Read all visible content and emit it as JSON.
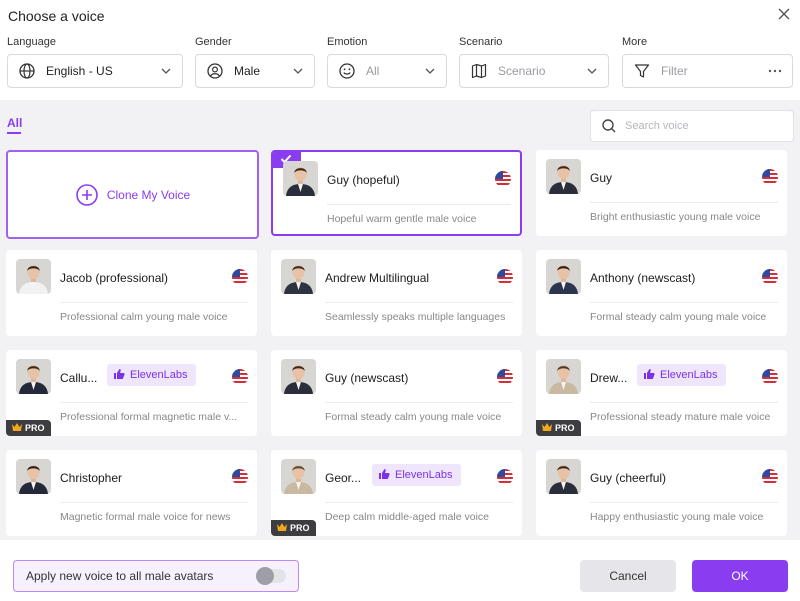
{
  "dialog": {
    "title": "Choose a voice"
  },
  "filters": {
    "language": {
      "label": "Language",
      "value": "English - US"
    },
    "gender": {
      "label": "Gender",
      "value": "Male"
    },
    "emotion": {
      "label": "Emotion",
      "value": "All"
    },
    "scenario": {
      "label": "Scenario",
      "value": "Scenario"
    },
    "more": {
      "label": "More",
      "value": "Filter"
    }
  },
  "tabs": {
    "all": "All"
  },
  "search": {
    "placeholder": "Search voice"
  },
  "clone": {
    "label": "Clone My Voice"
  },
  "badges": {
    "eleven": "ElevenLabs",
    "pro": "PRO"
  },
  "cards": [
    {
      "name": "Guy (hopeful)",
      "desc": "Hopeful warm gentle male voice",
      "selected": true,
      "suit": "#2a2d3a",
      "hair": "#3a2a1e"
    },
    {
      "name": "Guy",
      "desc": "Bright enthusiastic young male voice",
      "suit": "#2a2d3a",
      "hair": "#3a2a1e"
    },
    {
      "name": "Jacob (professional)",
      "desc": "Professional calm young male voice",
      "suit": "#f2f2f2",
      "hair": "#2e241c"
    },
    {
      "name": "Andrew Multilingual",
      "desc": "Seamlessly speaks multiple languages",
      "suit": "#2f3340",
      "hair": "#3b2c20"
    },
    {
      "name": "Anthony (newscast)",
      "desc": "Formal steady calm young male voice",
      "suit": "#2b3550",
      "hair": "#2a1f18"
    },
    {
      "name": "Callu...",
      "desc": "Professional formal magnetic male v...",
      "eleven": true,
      "pro": true,
      "suit": "#23283a",
      "hair": "#3a2a1e"
    },
    {
      "name": "Guy (newscast)",
      "desc": "Formal steady calm young male voice",
      "suit": "#2a2d3a",
      "hair": "#3a2a1e"
    },
    {
      "name": "Drew...",
      "desc": "Professional steady mature male voice",
      "eleven": true,
      "pro": true,
      "suit": "#c8b9a0",
      "hair": "#4a3a2c"
    },
    {
      "name": "Christopher",
      "desc": "Magnetic formal male voice for news",
      "suit": "#23283a",
      "hair": "#2a1f18"
    },
    {
      "name": "Geor...",
      "desc": "Deep calm middle-aged male voice",
      "eleven": true,
      "pro": true,
      "suit": "#c8b9a0",
      "hair": "#5a4a3a"
    },
    {
      "name": "Guy (cheerful)",
      "desc": "Happy enthusiastic young male voice",
      "suit": "#2a2d3a",
      "hair": "#3a2a1e"
    }
  ],
  "footer": {
    "apply_label": "Apply new voice to all male avatars",
    "cancel": "Cancel",
    "ok": "OK"
  },
  "colors": {
    "accent": "#8a3cf0",
    "background": "#f2f2f4"
  }
}
